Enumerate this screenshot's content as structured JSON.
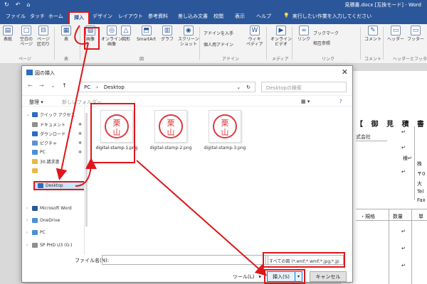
{
  "app": {
    "qat": [
      "↻",
      "↶",
      "⌂"
    ],
    "doc_title": "見積書.docx [互換モード] - Word"
  },
  "tabs": [
    {
      "label": "ファイル"
    },
    {
      "label": "タッチ"
    },
    {
      "label": "ホーム"
    },
    {
      "label": "挿入"
    },
    {
      "label": "デザイン"
    },
    {
      "label": "レイアウト"
    },
    {
      "label": "参考資料"
    },
    {
      "label": "差し込み文書"
    },
    {
      "label": "校閲"
    },
    {
      "label": "表示"
    },
    {
      "label": "ヘルプ"
    }
  ],
  "tell_me": {
    "icon": "💡",
    "text": "実行したい作業を入力してください"
  },
  "ribbon": {
    "buttons": [
      {
        "label": "表紙",
        "sub": "",
        "icon": "▤"
      },
      {
        "label": "空白の",
        "sub": "ページ",
        "icon": "□"
      },
      {
        "label": "ページ",
        "sub": "区切り",
        "icon": "⊟"
      },
      {
        "label": "表",
        "sub": "",
        "icon": "▦"
      },
      {
        "label": "画像",
        "sub": "",
        "icon": "▨"
      },
      {
        "label": "オンライン",
        "sub": "画像",
        "icon": "◎"
      },
      {
        "label": "図形",
        "sub": "",
        "icon": "△"
      },
      {
        "label": "SmartArt",
        "sub": "",
        "icon": "⬒"
      },
      {
        "label": "グラフ",
        "sub": "",
        "icon": "▥"
      },
      {
        "label": "スクリーン",
        "sub": "ショット",
        "icon": "◉"
      },
      {
        "label": "ウィキ",
        "sub": "ペディア",
        "icon": "W"
      },
      {
        "label": "オンライン",
        "sub": "ビデオ",
        "icon": "▶"
      },
      {
        "label": "リンク",
        "sub": "",
        "icon": "∞"
      },
      {
        "label": "ブックマーク",
        "sub": "",
        "icon": "⚑"
      },
      {
        "label": "相互参照",
        "sub": "",
        "icon": "⇄"
      },
      {
        "label": "コメント",
        "sub": "",
        "icon": "✎"
      },
      {
        "label": "ヘッダー",
        "sub": "",
        "icon": "▭"
      },
      {
        "label": "フッター",
        "sub": "",
        "icon": "▭"
      }
    ],
    "small": [
      "アドインを入手",
      "個人用アドイン"
    ],
    "groups": [
      "ページ",
      "表",
      "図",
      "アドイン",
      "メディア",
      "リンク",
      "コメント",
      "ヘッダーとフッター"
    ]
  },
  "dialog": {
    "title": "図の挿入",
    "close": "✕",
    "nav": {
      "back": "←",
      "forward": "→",
      "recent": "⌄",
      "up": "↑"
    },
    "breadcrumb": [
      "PC",
      "›",
      "Desktop"
    ],
    "address_dropdown": "⌄",
    "refresh": "↻",
    "search_placeholder": "Desktopの検索",
    "toolbar": {
      "organize": "整理 ▾",
      "new_folder": "新しいフォルダー",
      "view": "▦ ▾",
      "help": "?"
    },
    "nav_items": [
      {
        "label": "クイック アクセス",
        "icon_color": "#2b6cc4",
        "chev": "⌄",
        "pin": ""
      },
      {
        "label": "ドキュメント",
        "icon_color": "#8f8f8f",
        "chev": "",
        "pin": "✱"
      },
      {
        "label": "ダウンロード",
        "icon_color": "#2b6cc4",
        "chev": "",
        "pin": "✱"
      },
      {
        "label": "ピクチャ",
        "icon_color": "#5d8fd6",
        "chev": "",
        "pin": "✱"
      },
      {
        "label": "PC",
        "icon_color": "#4a90d9",
        "chev": "",
        "pin": "✱"
      },
      {
        "label": "30.請求書",
        "icon_color": "#e8b84a",
        "chev": "",
        "pin": ""
      },
      {
        "label": "",
        "icon_color": "#e8b84a",
        "chev": "",
        "pin": ""
      },
      {
        "label": "Desktop",
        "icon_color": "#2b6cc4",
        "chev": "",
        "pin": ""
      },
      {
        "label": "Microsoft Word",
        "icon_color": "#2b579a",
        "chev": "›",
        "pin": ""
      },
      {
        "label": "OneDrive",
        "icon_color": "#4a90d9",
        "chev": "›",
        "pin": ""
      },
      {
        "label": "PC",
        "icon_color": "#4a90d9",
        "chev": "›",
        "pin": ""
      },
      {
        "label": "SP PHD U3 (G:)",
        "icon_color": "#8f8f8f",
        "chev": "›",
        "pin": ""
      }
    ],
    "files": [
      {
        "name": "digital-stamp-1.png",
        "stamp": [
          "栗",
          "山"
        ]
      },
      {
        "name": "digital-stamp-2.png",
        "stamp": [
          "栗",
          "山"
        ]
      },
      {
        "name": "digital-stamp-3.png",
        "stamp": [
          "栗",
          "山"
        ]
      }
    ],
    "filename_label": "ファイル名(N):",
    "filename_value": "",
    "filetype": "すべての図 (*.emf;*.wmf;*.jpg;*.jp",
    "tools": "ツール(L)",
    "tools_caret": "▾",
    "insert": "挿入(S)",
    "insert_caret": "▾",
    "cancel": "キャンセル"
  },
  "document": {
    "heading": "【 御 見 積 書 】",
    "company": "式会社",
    "lines": [
      "↵",
      "↵",
      "様↵",
      "↵",
      "株",
      "〒0",
      "大",
      "Tel",
      "Fax"
    ],
    "table_headers": [
      "・規格",
      "数量",
      "単"
    ],
    "cell_mark": "↵"
  },
  "colors": {
    "title_blue": "#2b579a",
    "highlight_red": "#e0161a",
    "stamp_red": "#e0383e",
    "selection_blue": "#cce4f7"
  }
}
